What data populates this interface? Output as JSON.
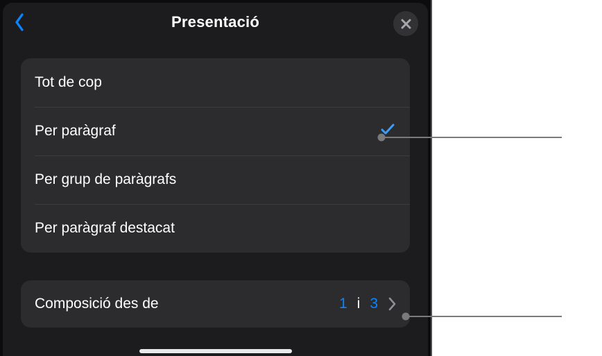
{
  "header": {
    "title": "Presentació"
  },
  "options": {
    "0": {
      "label": "Tot de cop",
      "selected": false
    },
    "1": {
      "label": "Per paràgraf",
      "selected": true
    },
    "2": {
      "label": "Per grup de paràgrafs",
      "selected": false
    },
    "3": {
      "label": "Per paràgraf destacat",
      "selected": false
    }
  },
  "buildFrom": {
    "label": "Composició des de",
    "start": "1",
    "separator": "i",
    "end": "3"
  }
}
